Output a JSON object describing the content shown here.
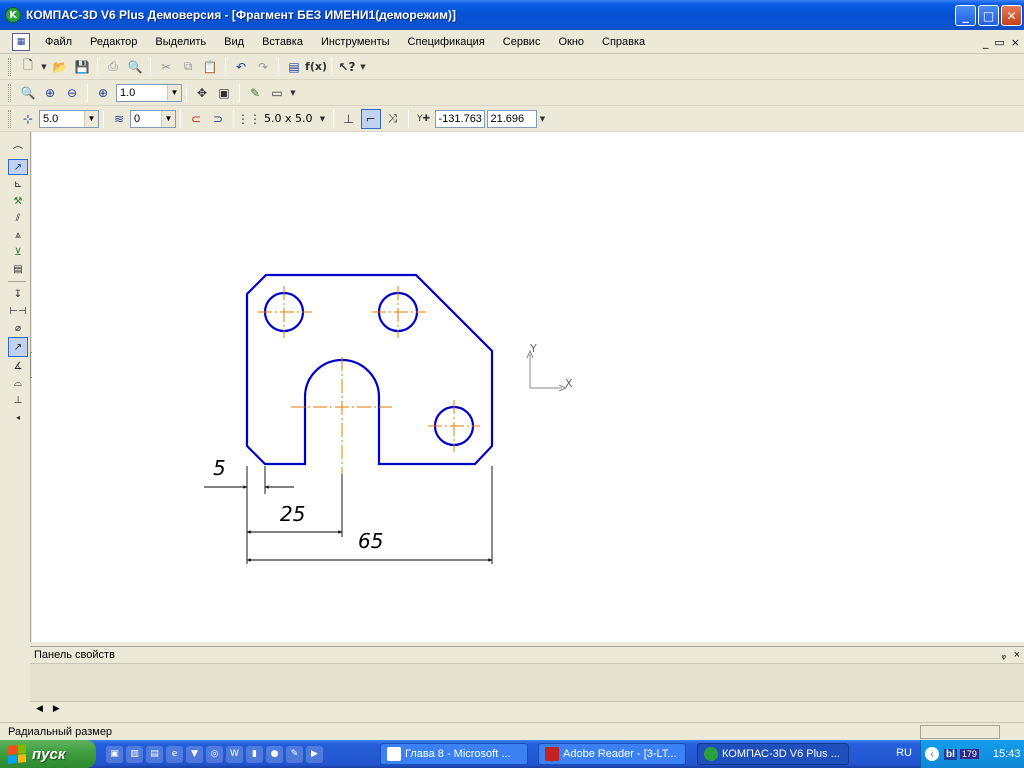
{
  "window": {
    "title": "КОМПАС-3D V6 Plus Демоверсия - [Фрагмент БЕЗ ИМЕНИ1(деморежим)]",
    "app_icon": "kompas-logo-icon",
    "buttons": {
      "minimize": "_",
      "maximize": "□",
      "close": "✕"
    }
  },
  "menu": {
    "items": [
      "Файл",
      "Редактор",
      "Выделить",
      "Вид",
      "Вставка",
      "Инструменты",
      "Спецификация",
      "Сервис",
      "Окно",
      "Справка"
    ],
    "mdi_buttons": {
      "minimize": "_",
      "restore": "▭",
      "close": "×"
    }
  },
  "toolbar_view": {
    "zoom_value": "1.0"
  },
  "toolbar_current": {
    "snap_step": "5.0",
    "layer": "0",
    "grid": "5.0 x 5.0",
    "coord_label": "Y",
    "cursor_x": "-131.763",
    "cursor_y": "21.696"
  },
  "flyout": {
    "icons": [
      "radial-dimension-icon",
      "radial-dimension-alt-icon"
    ]
  },
  "drawing": {
    "dimensions": {
      "d1": "5",
      "d2": "25",
      "d3": "65"
    },
    "axis_labels": {
      "x": "X",
      "y": "Y"
    },
    "colors": {
      "contour": "#0000cc",
      "centerline": "#e07800",
      "dimension": "#000000"
    }
  },
  "properties_panel": {
    "title": "Панель свойств",
    "pin": "ᵩ",
    "close": "×"
  },
  "status": {
    "text": "Радиальный размер"
  },
  "taskbar": {
    "start": "пуск",
    "tasks": [
      "Глава 8 - Microsoft ...",
      "Adobe Reader - [3-LT...",
      "КОМПАС-3D V6 Plus ..."
    ],
    "language": "RU",
    "tray_badge": "179",
    "clock": "15:43"
  }
}
